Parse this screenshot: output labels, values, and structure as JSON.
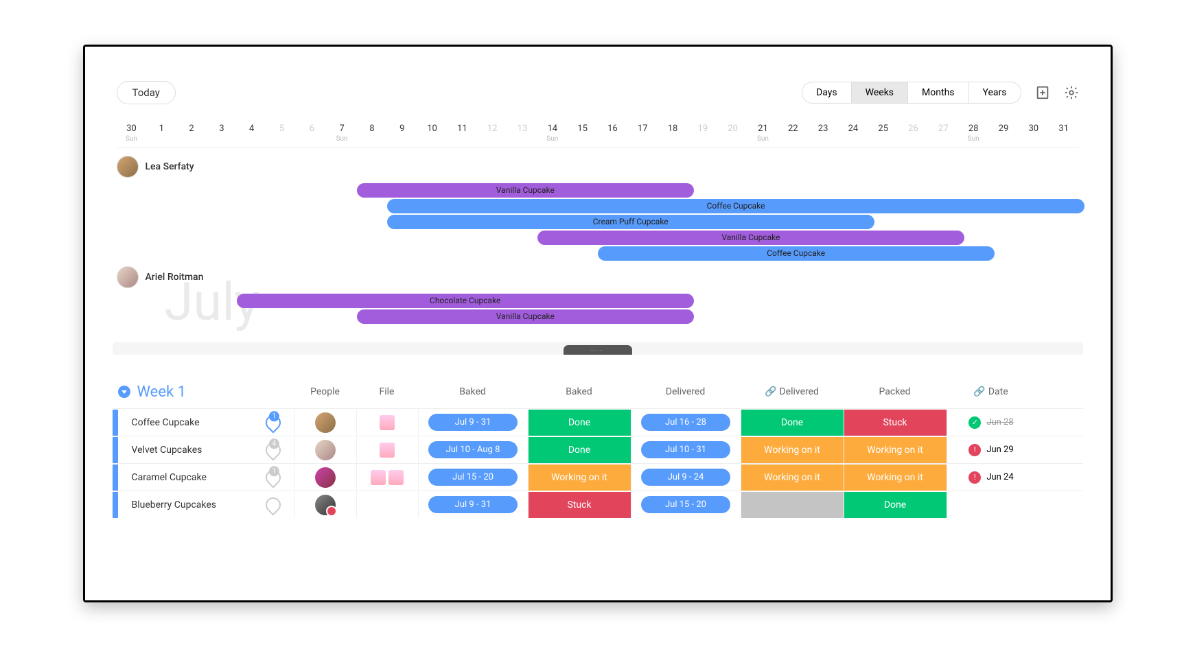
{
  "toolbar": {
    "today": "Today",
    "views": [
      "Days",
      "Weeks",
      "Months",
      "Years"
    ],
    "active_view": "Weeks"
  },
  "ruler": {
    "days": [
      {
        "n": "30",
        "faded": false,
        "sun": "Sun"
      },
      {
        "n": "1"
      },
      {
        "n": "2"
      },
      {
        "n": "3"
      },
      {
        "n": "4"
      },
      {
        "n": "5",
        "faded": true
      },
      {
        "n": "6",
        "faded": true
      },
      {
        "n": "7",
        "sun": "Sun"
      },
      {
        "n": "8"
      },
      {
        "n": "9"
      },
      {
        "n": "10"
      },
      {
        "n": "11"
      },
      {
        "n": "12",
        "faded": true
      },
      {
        "n": "13",
        "faded": true
      },
      {
        "n": "14",
        "sun": "Sun"
      },
      {
        "n": "15"
      },
      {
        "n": "16"
      },
      {
        "n": "17"
      },
      {
        "n": "18"
      },
      {
        "n": "19",
        "faded": true
      },
      {
        "n": "20",
        "faded": true
      },
      {
        "n": "21",
        "sun": "Sun"
      },
      {
        "n": "22"
      },
      {
        "n": "23"
      },
      {
        "n": "24"
      },
      {
        "n": "25"
      },
      {
        "n": "26",
        "faded": true
      },
      {
        "n": "27",
        "faded": true
      },
      {
        "n": "28",
        "sun": "Sun"
      },
      {
        "n": "29"
      },
      {
        "n": "30"
      },
      {
        "n": "31"
      }
    ],
    "month_bg": "July"
  },
  "gantt": {
    "people": [
      {
        "name": "Lea Serfaty",
        "avatar": "f",
        "bars": [
          {
            "label": "Vanilla Cupcake",
            "color": "purple",
            "start": 8,
            "end": 18
          },
          {
            "label": "Coffee Cupcake",
            "color": "blue",
            "start": 9,
            "end": 31
          },
          {
            "label": "Cream Puff Cupcake",
            "color": "blue",
            "start": 9,
            "end": 24
          },
          {
            "label": "Vanilla Cupcake",
            "color": "purple",
            "start": 14,
            "end": 27
          },
          {
            "label": "Coffee Cupcake",
            "color": "blue",
            "start": 16,
            "end": 28
          }
        ]
      },
      {
        "name": "Ariel Roitman",
        "avatar": "m",
        "bars": [
          {
            "label": "Chocolate Cupcake",
            "color": "purple",
            "start": 4,
            "end": 18
          },
          {
            "label": "Vanilla Cupcake",
            "color": "purple",
            "start": 8,
            "end": 18
          }
        ]
      }
    ]
  },
  "table": {
    "group": "Week 1",
    "columns": [
      "People",
      "File",
      "Baked",
      "Baked",
      "Delivered",
      "Delivered",
      "Packed",
      "Date"
    ],
    "linked_cols": [
      5,
      7
    ],
    "rows": [
      {
        "name": "Coffee Cupcake",
        "comment_count": 1,
        "comment_active": true,
        "avatar": "f",
        "files": 1,
        "baked": "Jul 9 - 31",
        "baked_status": "Done",
        "delivered": "Jul 16 - 28",
        "delivered_status": "Done",
        "packed": "Stuck",
        "date": "Jun 28",
        "date_icon": "ok",
        "date_strike": true
      },
      {
        "name": "Velvet Cupcakes",
        "comment_count": 4,
        "comment_active": false,
        "avatar": "m",
        "files": 1,
        "baked": "Jul 10 - Aug 8",
        "baked_status": "Done",
        "delivered": "Jul 10 - 31",
        "delivered_status": "Working on it",
        "packed": "Working on it",
        "date": "Jun 29",
        "date_icon": "warn"
      },
      {
        "name": "Caramel Cupcake",
        "comment_count": 1,
        "comment_active": false,
        "avatar": "f2",
        "files": 2,
        "baked": "Jul 15 - 20",
        "baked_status": "Working on it",
        "delivered": "Jul 9 - 24",
        "delivered_status": "Working on it",
        "packed": "Working on it",
        "date": "Jun 24",
        "date_icon": "warn"
      },
      {
        "name": "Blueberry Cupcakes",
        "comment_count": 0,
        "comment_active": false,
        "avatar": "bw",
        "files": 0,
        "baked": "Jul 9 - 31",
        "baked_status": "Stuck",
        "delivered": "Jul 15 - 20",
        "delivered_status": "",
        "packed": "Done",
        "date": "",
        "date_icon": ""
      }
    ]
  }
}
